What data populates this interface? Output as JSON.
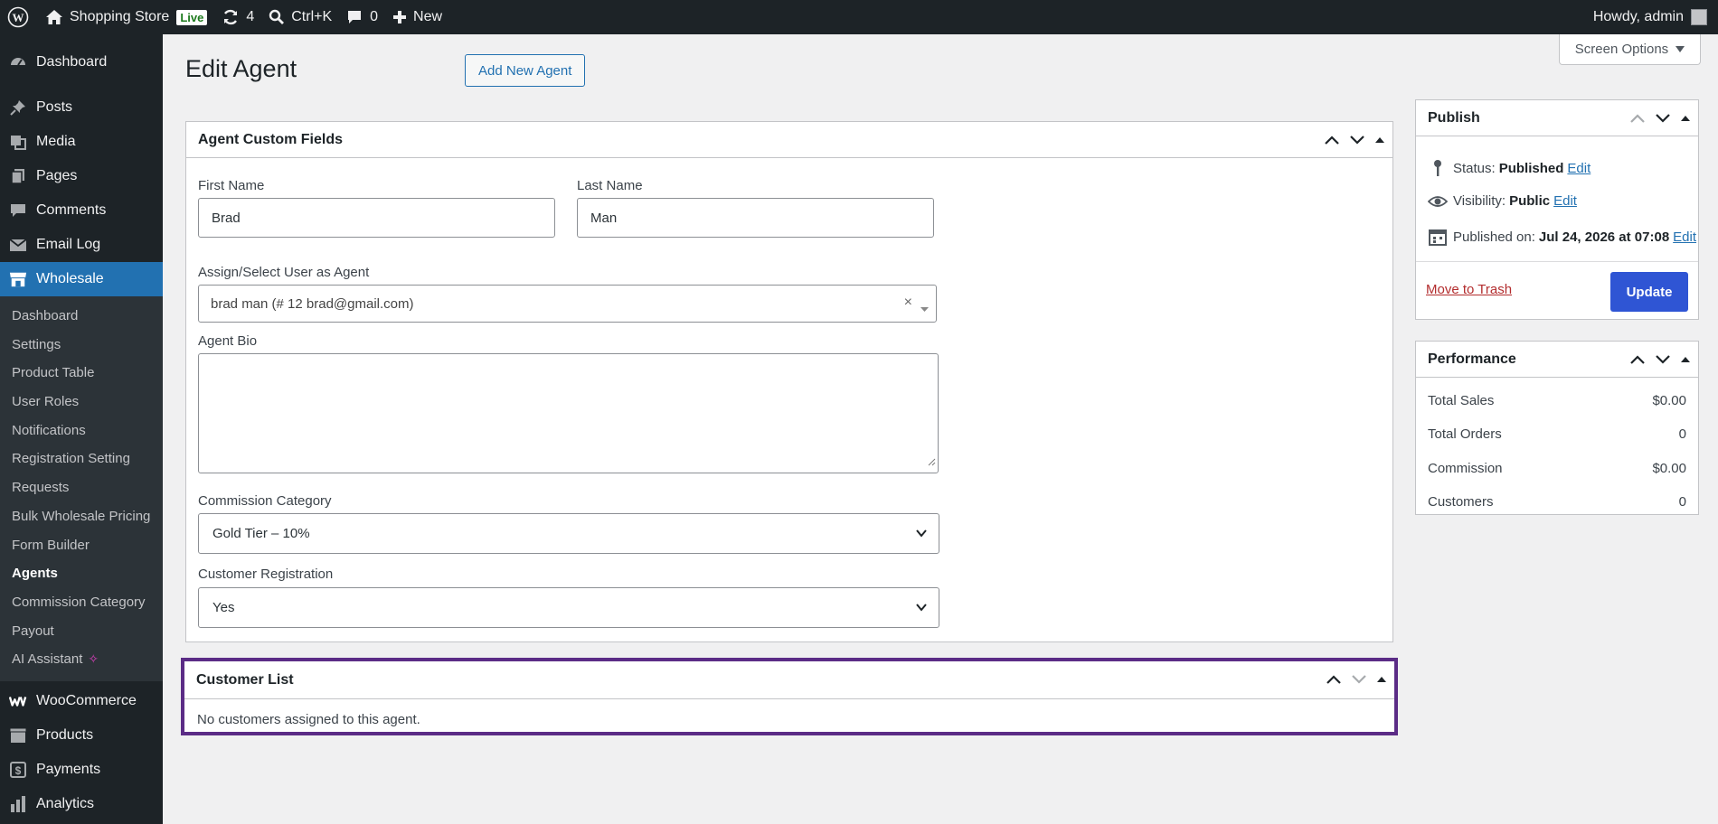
{
  "admin_bar": {
    "site_name": "Shopping Store",
    "live_badge": "Live",
    "updates_count": "4",
    "search_shortcut": "Ctrl+K",
    "comments_count": "0",
    "new_label": "New",
    "greeting": "Howdy, admin"
  },
  "sidebar": {
    "top_items": [
      {
        "label": "Dashboard",
        "icon": "dashboard-icon"
      },
      {
        "label": "Posts",
        "icon": "pin-icon"
      },
      {
        "label": "Media",
        "icon": "media-icon"
      },
      {
        "label": "Pages",
        "icon": "pages-icon"
      },
      {
        "label": "Comments",
        "icon": "comment-icon"
      },
      {
        "label": "Email Log",
        "icon": "email-icon"
      },
      {
        "label": "Wholesale",
        "icon": "store-icon"
      }
    ],
    "submenu": [
      "Dashboard",
      "Settings",
      "Product Table",
      "User Roles",
      "Notifications",
      "Registration Setting",
      "Requests",
      "Bulk Wholesale Pricing",
      "Form Builder",
      "Agents",
      "Commission Category",
      "Payout",
      "AI Assistant"
    ],
    "bottom_items": [
      {
        "label": "WooCommerce",
        "icon": "woo-icon"
      },
      {
        "label": "Products",
        "icon": "products-icon"
      },
      {
        "label": "Payments",
        "icon": "payments-icon"
      },
      {
        "label": "Analytics",
        "icon": "analytics-icon"
      }
    ]
  },
  "page": {
    "title": "Edit Agent",
    "add_new_button": "Add New Agent",
    "screen_options": "Screen Options"
  },
  "custom_fields": {
    "title": "Agent Custom Fields",
    "first_name_label": "First Name",
    "first_name_value": "Brad",
    "last_name_label": "Last Name",
    "last_name_value": "Man",
    "assign_label": "Assign/Select User as Agent",
    "assign_value": "brad man (# 12 brad@gmail.com)",
    "bio_label": "Agent Bio",
    "commission_label": "Commission Category",
    "commission_value": "Gold Tier – 10%",
    "registration_label": "Customer Registration",
    "registration_value": "Yes"
  },
  "customer_list": {
    "title": "Customer List",
    "empty_text": "No customers assigned to this agent."
  },
  "publish": {
    "title": "Publish",
    "status_label": "Status:",
    "status_value": "Published",
    "visibility_label": "Visibility:",
    "visibility_value": "Public",
    "published_label": "Published on:",
    "published_value": "Jul 24, 2026 at 07:08",
    "edit_link": "Edit",
    "trash_link": "Move to Trash",
    "update_button": "Update"
  },
  "performance": {
    "title": "Performance",
    "rows": [
      {
        "label": "Total Sales",
        "value": "$0.00"
      },
      {
        "label": "Total Orders",
        "value": "0"
      },
      {
        "label": "Commission",
        "value": "$0.00"
      },
      {
        "label": "Customers",
        "value": "0"
      }
    ]
  },
  "colors": {
    "admin_bar": "#1d2327",
    "accent": "#2271b1",
    "update_button": "#2f55d4",
    "highlight_border": "#5b2c86",
    "trash": "#b32d2e"
  }
}
